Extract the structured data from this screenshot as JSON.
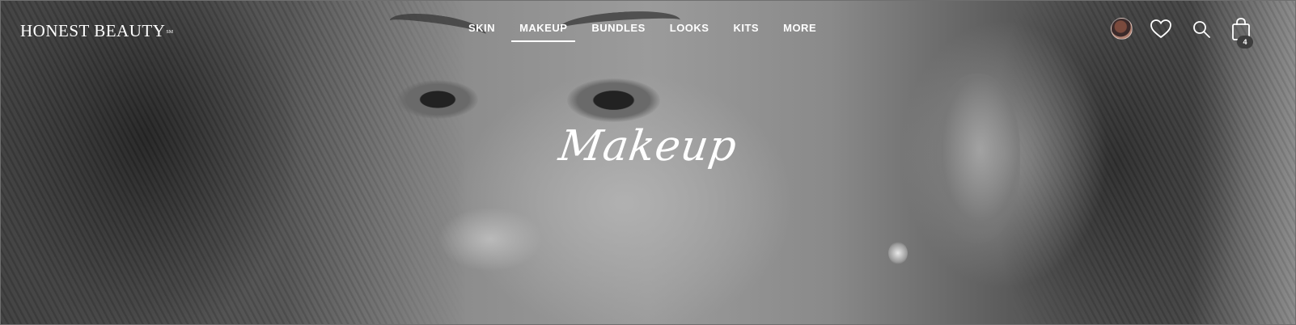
{
  "brand": {
    "logo_text": "HONEST BEAUTY",
    "logo_mark": "SM"
  },
  "nav": {
    "items": [
      {
        "label": "SKIN",
        "active": false
      },
      {
        "label": "MAKEUP",
        "active": true
      },
      {
        "label": "BUNDLES",
        "active": false
      },
      {
        "label": "LOOKS",
        "active": false
      },
      {
        "label": "KITS",
        "active": false
      },
      {
        "label": "MORE",
        "active": false
      }
    ]
  },
  "header_icons": {
    "avatar": "user-avatar",
    "wishlist": "heart-icon",
    "search": "search-icon",
    "cart": "shopping-bag-icon",
    "cart_count": "4"
  },
  "hero": {
    "title": "Makeup"
  },
  "colors": {
    "text": "#ffffff",
    "badge": "#3d3d3d"
  }
}
